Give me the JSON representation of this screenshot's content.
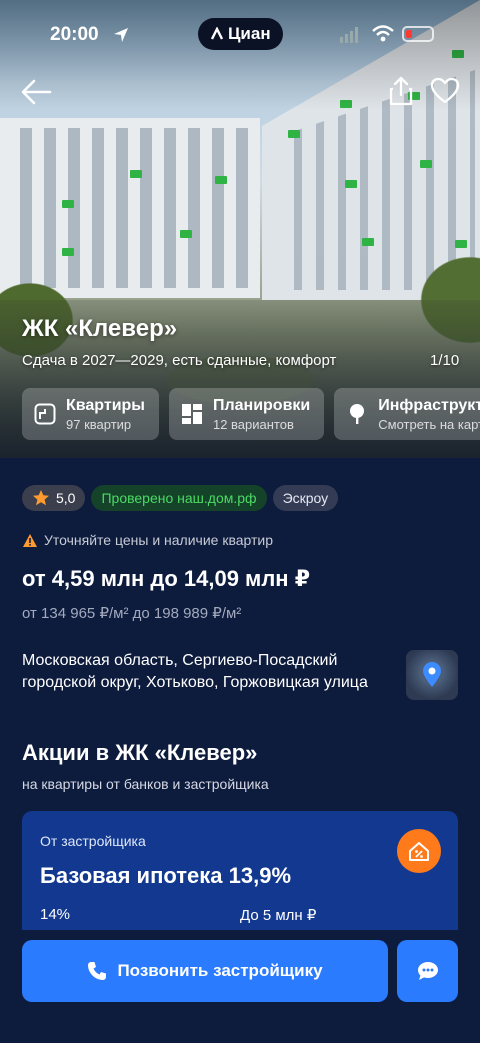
{
  "status_bar": {
    "time": "20:00",
    "brand": "Циан"
  },
  "hero": {
    "title": "ЖК «Клевер»",
    "subtitle": "Сдача в 2027—2029, есть сданные, комфорт",
    "photo_counter": "1/10",
    "chips": [
      {
        "label": "Квартиры",
        "sub": "97 квартир",
        "icon": "apartments-icon"
      },
      {
        "label": "Планировки",
        "sub": "12 вариантов",
        "icon": "layouts-icon"
      },
      {
        "label": "Инфраструктура",
        "sub": "Смотреть на карте",
        "icon": "tree-icon"
      }
    ]
  },
  "badges": {
    "rating": "5,0",
    "verified": "Проверено наш.дом.рф",
    "escrow": "Эскроу"
  },
  "warning": "Уточняйте цены и наличие квартир",
  "price": "от 4,59 млн до 14,09 млн ₽",
  "price_per_sqm": "от 134 965 ₽/м² до 198 989 ₽/м²",
  "address": "Московская область, Сергиево-Посадский городской округ, Хотьково, Горжовицкая улица",
  "promotions": {
    "title": "Акции в ЖК «Клевер»",
    "subtitle": "на квартиры от банков и застройщика",
    "card": {
      "source": "От застройщика",
      "name": "Базовая ипотека 13,9%",
      "rate": "14%",
      "limit": "До 5 млн ₽"
    }
  },
  "actions": {
    "call": "Позвонить застройщику"
  },
  "colors": {
    "background": "#0d1b3d",
    "accent": "#2b7bff",
    "promo_card": "#12398f",
    "verified_text": "#4cd964",
    "promo_icon": "#ff7a1a"
  }
}
